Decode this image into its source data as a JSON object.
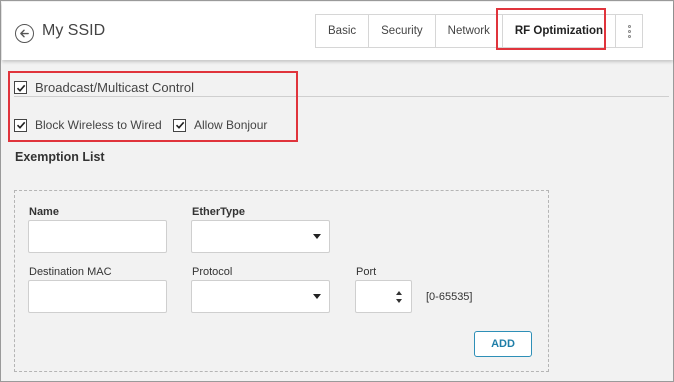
{
  "header": {
    "title": "My SSID",
    "tabs": [
      {
        "label": "Basic",
        "active": false
      },
      {
        "label": "Security",
        "active": false
      },
      {
        "label": "Network",
        "active": false
      },
      {
        "label": "RF Optimization",
        "active": true
      }
    ],
    "more_icon": "kebab-vertical-icon"
  },
  "broadcast": {
    "label": "Broadcast/Multicast Control",
    "checked": true,
    "options": [
      {
        "label": "Block Wireless to Wired",
        "checked": true
      },
      {
        "label": "Allow Bonjour",
        "checked": true
      }
    ]
  },
  "exemption": {
    "title": "Exemption List",
    "name_label": "Name",
    "name_value": "",
    "ethertype_label": "EtherType",
    "ethertype_value": "",
    "dest_mac_label": "Destination MAC",
    "dest_mac_value": "",
    "protocol_label": "Protocol",
    "protocol_value": "",
    "port_label": "Port",
    "port_value": "",
    "port_range": "[0-65535]",
    "add_label": "ADD"
  },
  "colors": {
    "highlight": "#e0343c",
    "accent": "#2e8fb7"
  }
}
